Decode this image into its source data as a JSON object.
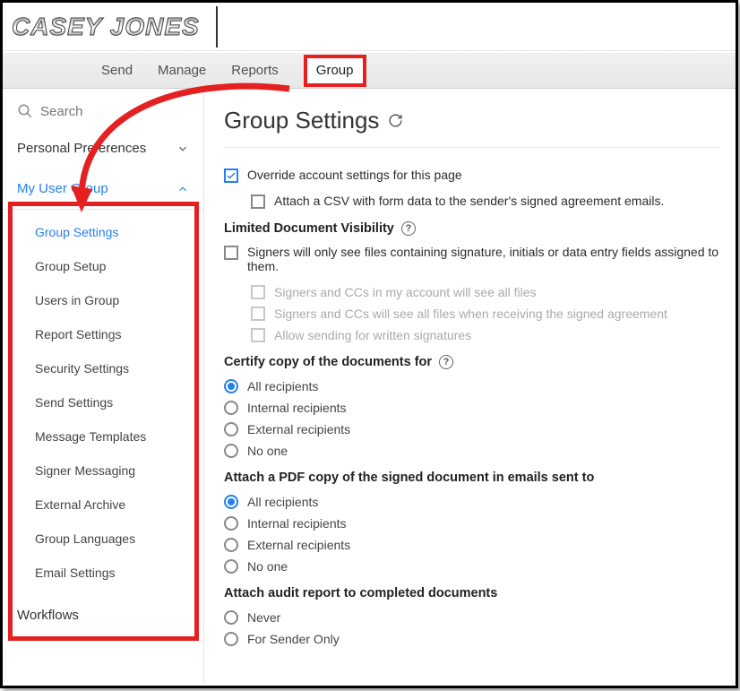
{
  "logo": "CASEY JONES",
  "topnav": {
    "send": "Send",
    "manage": "Manage",
    "reports": "Reports",
    "group": "Group"
  },
  "sidebar": {
    "search_placeholder": "Search",
    "personal_prefs": "Personal Preferences",
    "my_user_group": "My User Group",
    "items": [
      "Group Settings",
      "Group Setup",
      "Users in Group",
      "Report Settings",
      "Security Settings",
      "Send Settings",
      "Message Templates",
      "Signer Messaging",
      "External Archive",
      "Group Languages",
      "Email Settings"
    ],
    "workflows": "Workflows"
  },
  "main": {
    "title": "Group Settings",
    "override_label": "Override account settings for this page",
    "attach_csv": "Attach a CSV with form data to the sender's signed agreement emails.",
    "ldv_title": "Limited Document Visibility",
    "ldv_main": "Signers will only see files containing signature, initials or data entry fields assigned to them.",
    "ldv_a": "Signers and CCs in my account will see all files",
    "ldv_b": "Signers and CCs will see all files when receiving the signed agreement",
    "ldv_c": "Allow sending for written signatures",
    "certify_title": "Certify copy of the documents for",
    "pdf_title": "Attach a PDF copy of the signed document in emails sent to",
    "audit_title": "Attach audit report to completed documents",
    "radio_all": "All recipients",
    "radio_internal": "Internal recipients",
    "radio_external": "External recipients",
    "radio_none": "No one",
    "radio_never": "Never",
    "radio_sender_only": "For Sender Only"
  }
}
